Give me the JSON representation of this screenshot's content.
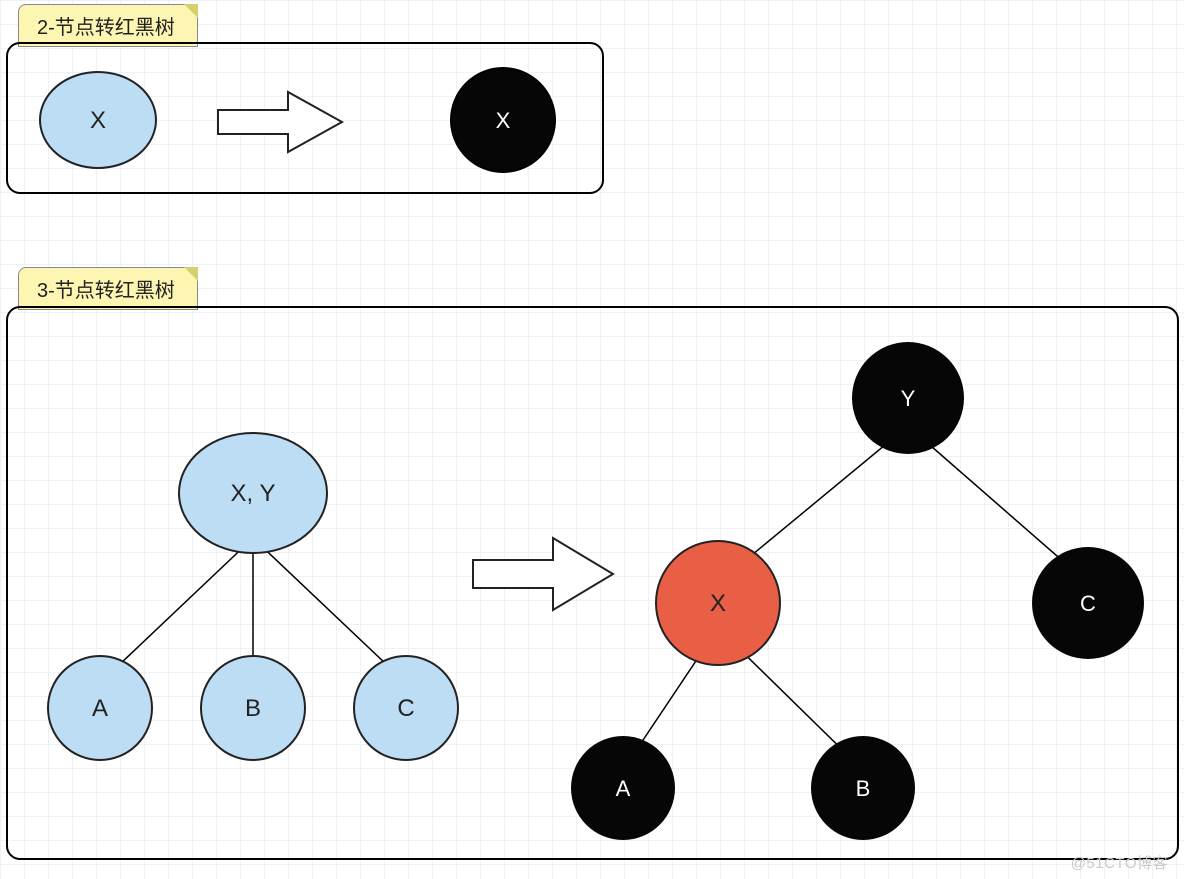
{
  "watermark": "@51CTO博客",
  "panel2": {
    "tag": "2-节点转红黑树",
    "before_node": {
      "label": "X",
      "color": "blue"
    },
    "after_node": {
      "label": "X",
      "color": "black"
    }
  },
  "panel3": {
    "tag": "3-节点转红黑树",
    "before_tree": {
      "root": {
        "label": "X, Y",
        "color": "blue"
      },
      "children": [
        {
          "label": "A",
          "color": "blue"
        },
        {
          "label": "B",
          "color": "blue"
        },
        {
          "label": "C",
          "color": "blue"
        }
      ]
    },
    "after_tree": {
      "root": {
        "label": "Y",
        "color": "black"
      },
      "left": {
        "label": "X",
        "color": "red"
      },
      "right": {
        "label": "C",
        "color": "black"
      },
      "left_left": {
        "label": "A",
        "color": "black"
      },
      "left_right": {
        "label": "B",
        "color": "black"
      }
    }
  },
  "colors": {
    "blue_fill": "#bdddf5",
    "red_fill": "#e85f45",
    "black_fill": "#060606",
    "stroke": "#222222",
    "text_dark": "#222222",
    "text_light": "#ffffff"
  }
}
